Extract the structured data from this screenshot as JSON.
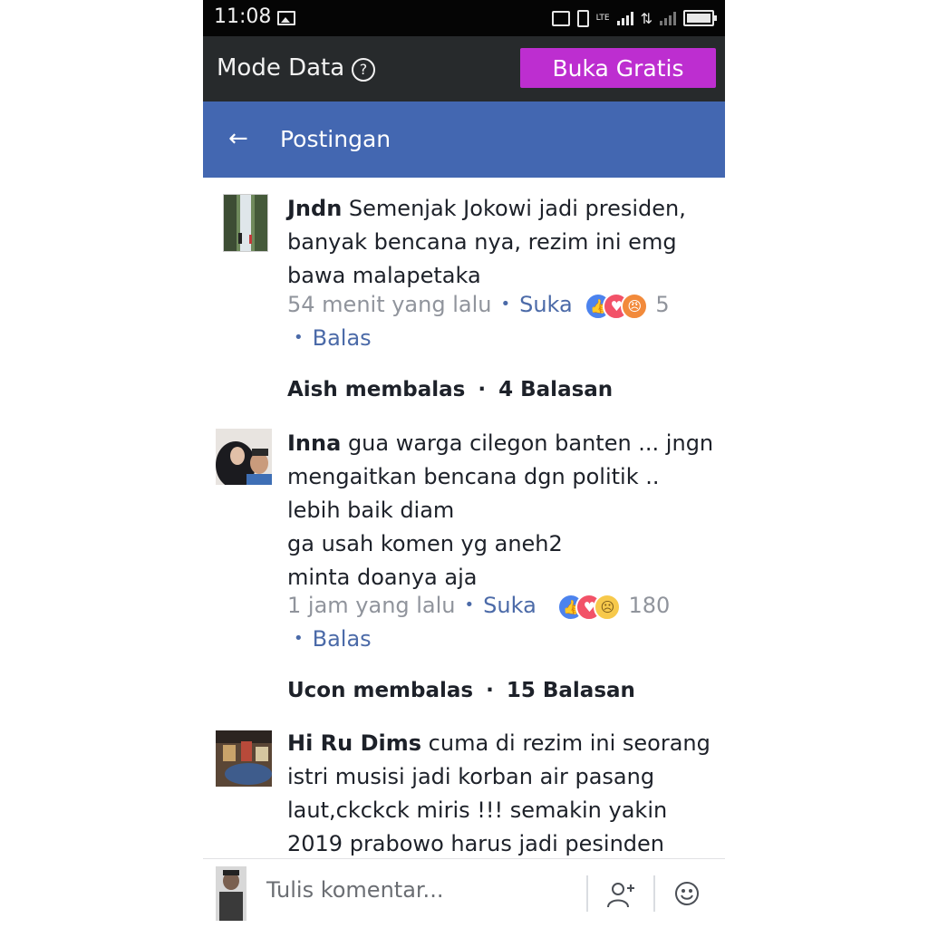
{
  "status_bar": {
    "time": "11:08",
    "lte": "LTE"
  },
  "mode_bar": {
    "label": "Mode Data",
    "help": "?",
    "free_button": "Buka Gratis"
  },
  "header": {
    "back": "←",
    "title": "Postingan"
  },
  "comments": [
    {
      "name": "Jndn",
      "lines": [
        "Semenjak Jokowi jadi presiden,",
        "banyak bencana nya, rezim ini emg",
        "bawa malapetaka"
      ],
      "time": "54 menit yang lalu",
      "like": "Suka",
      "reactions": [
        "like-icon",
        "love-icon",
        "angry-icon"
      ],
      "reaction_count": "5",
      "reply": "Balas",
      "replies_by": "Aish membalas",
      "replies_count": "4 Balasan"
    },
    {
      "name": "Inna",
      "lines": [
        "gua warga cilegon banten ... jngn",
        "mengaitkan bencana dgn politik ..",
        "lebih baik diam",
        "ga usah komen yg aneh2",
        "minta doanya aja"
      ],
      "time": "1 jam yang lalu",
      "like": "Suka",
      "reactions": [
        "like-icon",
        "love-icon",
        "sad-icon"
      ],
      "reaction_count": "180",
      "reply": "Balas",
      "replies_by": "Ucon membalas",
      "replies_count": "15 Balasan"
    },
    {
      "name": "Hi Ru Dims",
      "lines": [
        "cuma di rezim ini seorang",
        "istri musisi jadi korban air pasang",
        "laut,ckckck miris !!! semakin yakin",
        "2019 prabowo harus jadi pesinden"
      ]
    }
  ],
  "composer": {
    "placeholder": "Tulis komentar..."
  },
  "colors": {
    "header_blue": "#4367b1",
    "free_button": "#bd2ed0",
    "link_blue": "#4b6aa8"
  }
}
